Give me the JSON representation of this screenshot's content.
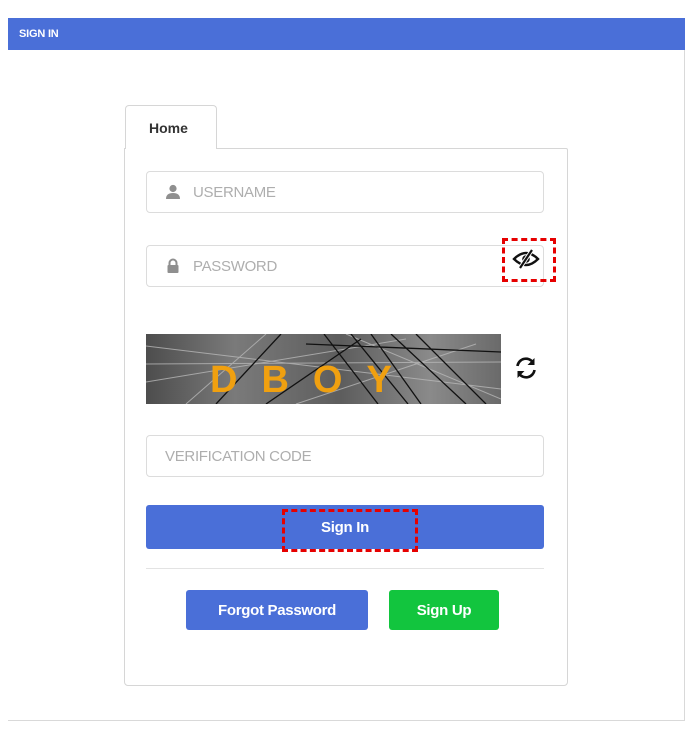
{
  "window": {
    "title": "SIGN IN"
  },
  "tabs": [
    {
      "label": "Home",
      "active": true
    }
  ],
  "form": {
    "username": {
      "placeholder": "USERNAME",
      "value": "",
      "icon": "user-icon"
    },
    "password": {
      "placeholder": "PASSWORD",
      "value": "",
      "icon": "lock-icon",
      "toggle_icon": "eye-slash-icon"
    },
    "captcha": {
      "text": "DBOY",
      "refresh_icon": "refresh-icon"
    },
    "verification_code": {
      "placeholder": "VERIFICATION CODE",
      "value": ""
    },
    "sign_in_label": "Sign In",
    "forgot_password_label": "Forgot Password",
    "sign_up_label": "Sign Up"
  },
  "colors": {
    "primary": "#4a6fd8",
    "success": "#12c53e",
    "highlight": "#e60000",
    "captcha_text": "#f0a010"
  }
}
